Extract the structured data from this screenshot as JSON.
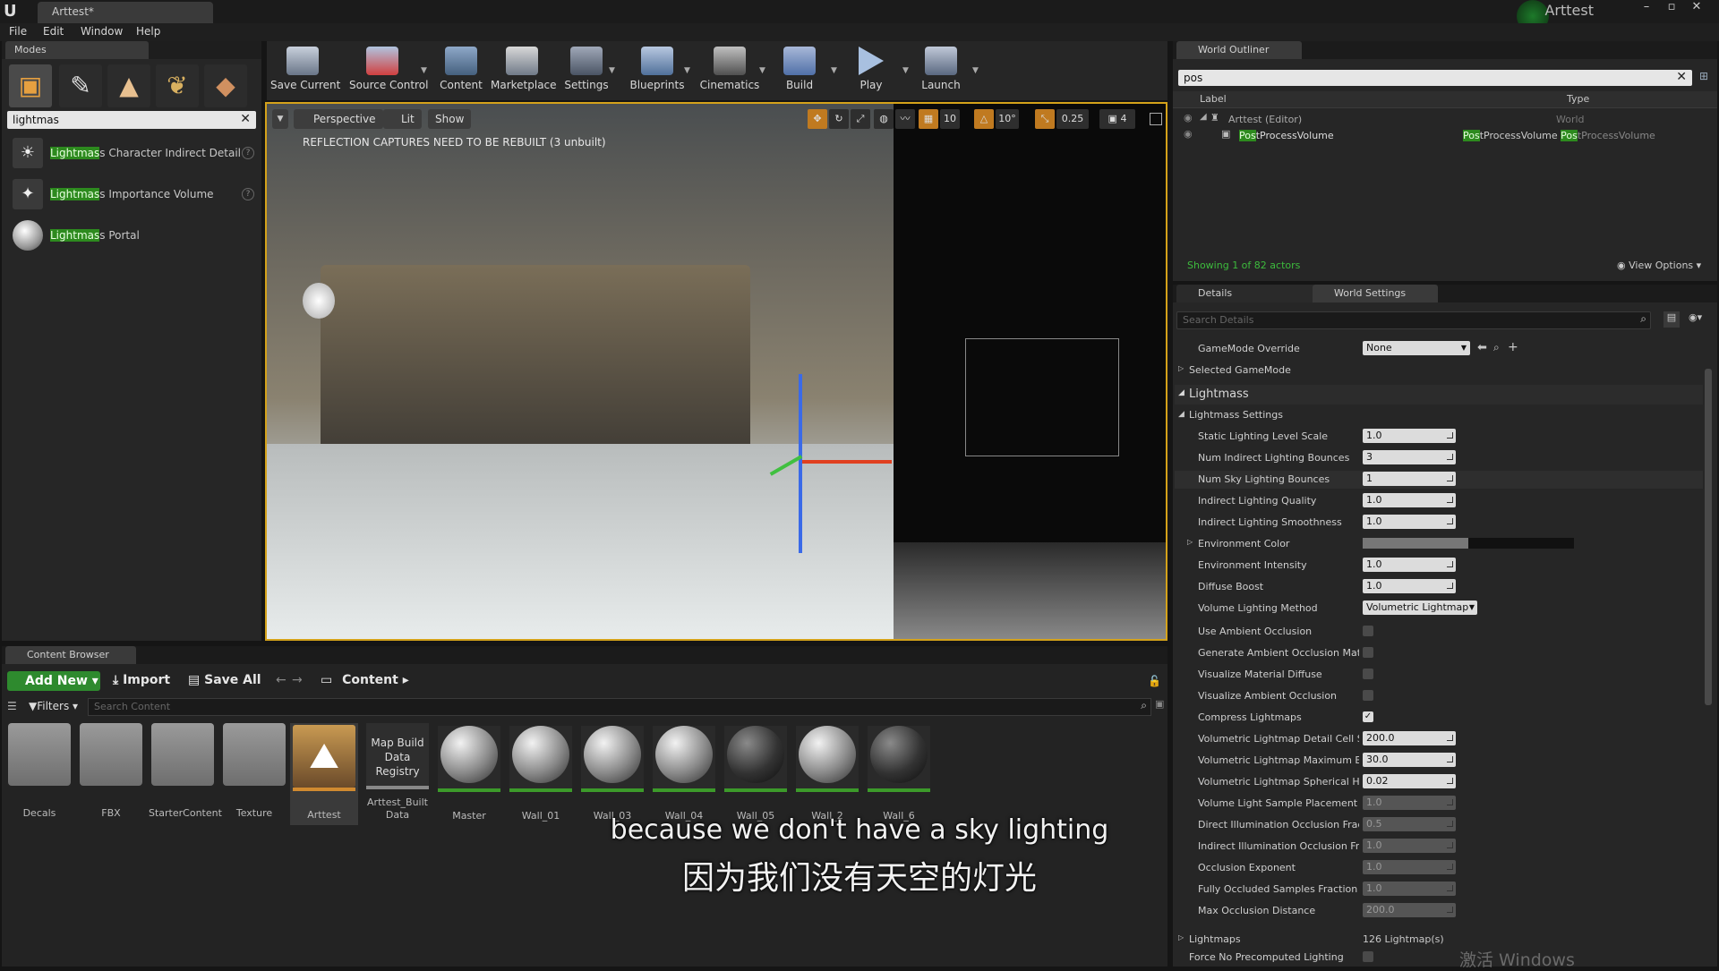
{
  "window": {
    "doc_tab": "Arttest*",
    "project_name": "Arttest"
  },
  "menu": [
    "File",
    "Edit",
    "Window",
    "Help"
  ],
  "modes": {
    "tab": "Modes",
    "search_value": "lightmas",
    "items": [
      {
        "highlight": "Lightmas",
        "rest": "s Character Indirect Detail"
      },
      {
        "highlight": "Lightmas",
        "rest": "s Importance Volume"
      },
      {
        "highlight": "Lightmas",
        "rest": "s Portal"
      }
    ]
  },
  "toolbar": {
    "buttons": [
      "Save Current",
      "Source Control",
      "Content",
      "Marketplace",
      "Settings",
      "Blueprints",
      "Cinematics",
      "Build",
      "Play",
      "Launch"
    ]
  },
  "viewport": {
    "perspective": "Perspective",
    "lit": "Lit",
    "show": "Show",
    "warning": "REFLECTION CAPTURES NEED TO BE REBUILT (3 unbuilt)",
    "grid_snap": "10",
    "rot_snap": "10°",
    "scale_snap": "0.25",
    "cam_speed": "4"
  },
  "outliner": {
    "tab": "World Outliner",
    "search_value": "pos",
    "col_label": "Label",
    "col_type": "Type",
    "rows": [
      {
        "label": "Arttest (Editor)",
        "type": "World"
      },
      {
        "label_hl": "Pos",
        "label_rest": "tProcessVolume",
        "type_a_hl": "Pos",
        "type_a_rest": "tProcessVolume",
        "type_b_hl": "Pos",
        "type_b_rest": "tProcessVolume"
      }
    ],
    "status": "Showing 1 of 82 actors",
    "view_options": "View Options"
  },
  "details": {
    "tab_details": "Details",
    "tab_world": "World Settings",
    "search_placeholder": "Search Details",
    "gamemode_label": "GameMode Override",
    "gamemode_value": "None",
    "selected_gamemode": "Selected GameMode",
    "section_lightmass": "Lightmass",
    "sub_settings": "Lightmass Settings",
    "props": [
      {
        "label": "Static Lighting Level Scale",
        "value": "1.0"
      },
      {
        "label": "Num Indirect Lighting Bounces",
        "value": "3"
      },
      {
        "label": "Num Sky Lighting Bounces",
        "value": "1"
      },
      {
        "label": "Indirect Lighting Quality",
        "value": "1.0"
      },
      {
        "label": "Indirect Lighting Smoothness",
        "value": "1.0"
      }
    ],
    "env_color": "Environment Color",
    "props2": [
      {
        "label": "Environment Intensity",
        "value": "1.0"
      },
      {
        "label": "Diffuse Boost",
        "value": "1.0"
      }
    ],
    "vol_method_label": "Volume Lighting Method",
    "vol_method_value": "Volumetric Lightmap",
    "checks": [
      {
        "label": "Use Ambient Occlusion",
        "on": false
      },
      {
        "label": "Generate Ambient Occlusion Material",
        "on": false
      },
      {
        "label": "Visualize Material Diffuse",
        "on": false
      },
      {
        "label": "Visualize Ambient Occlusion",
        "on": false
      },
      {
        "label": "Compress Lightmaps",
        "on": true
      }
    ],
    "props3": [
      {
        "label": "Volumetric Lightmap Detail Cell Size",
        "value": "200.0",
        "dim": false
      },
      {
        "label": "Volumetric Lightmap Maximum Brick",
        "value": "30.0",
        "dim": false
      },
      {
        "label": "Volumetric Lightmap Spherical Harm",
        "value": "0.02",
        "dim": false
      },
      {
        "label": "Volume Light Sample Placement Sc",
        "value": "1.0",
        "dim": true
      },
      {
        "label": "Direct Illumination Occlusion Fractic",
        "value": "0.5",
        "dim": true
      },
      {
        "label": "Indirect Illumination Occlusion Fract",
        "value": "1.0",
        "dim": true
      },
      {
        "label": "Occlusion Exponent",
        "value": "1.0",
        "dim": true
      },
      {
        "label": "Fully Occluded Samples Fraction",
        "value": "1.0",
        "dim": true
      },
      {
        "label": "Max Occlusion Distance",
        "value": "200.0",
        "dim": true
      }
    ],
    "lightmaps_label": "Lightmaps",
    "lightmaps_value": "126 Lightmap(s)",
    "force_no_precomp": "Force No Precomputed Lighting"
  },
  "content_browser": {
    "tab": "Content Browser",
    "add_new": "Add New",
    "import": "Import",
    "save_all": "Save All",
    "path": "Content",
    "filters": "Filters",
    "search_placeholder": "Search Content",
    "assets": [
      {
        "name": "Decals",
        "kind": "folder"
      },
      {
        "name": "FBX",
        "kind": "folder"
      },
      {
        "name": "StarterContent",
        "kind": "folder"
      },
      {
        "name": "Texture",
        "kind": "folder"
      },
      {
        "name": "Arttest",
        "kind": "level"
      },
      {
        "name": "Arttest_Built Data",
        "kind": "registry",
        "thumb_text": "Map Build Data Registry"
      },
      {
        "name": "Master",
        "kind": "sphere"
      },
      {
        "name": "Wall_01",
        "kind": "sphere"
      },
      {
        "name": "Wall_03",
        "kind": "sphere"
      },
      {
        "name": "Wall_04",
        "kind": "sphere"
      },
      {
        "name": "Wall_05",
        "kind": "dark"
      },
      {
        "name": "Wall_2",
        "kind": "sphere"
      },
      {
        "name": "Wall_6",
        "kind": "dark"
      }
    ]
  },
  "subtitle": {
    "en": "because we don't have a sky lighting",
    "zh": "因为我们没有天空的灯光"
  },
  "watermark": "激活 Windows",
  "colors": {
    "highlight": "#2d8a1e",
    "accent_green": "#3c9a2a",
    "viewport_border": "#d4a21a"
  }
}
